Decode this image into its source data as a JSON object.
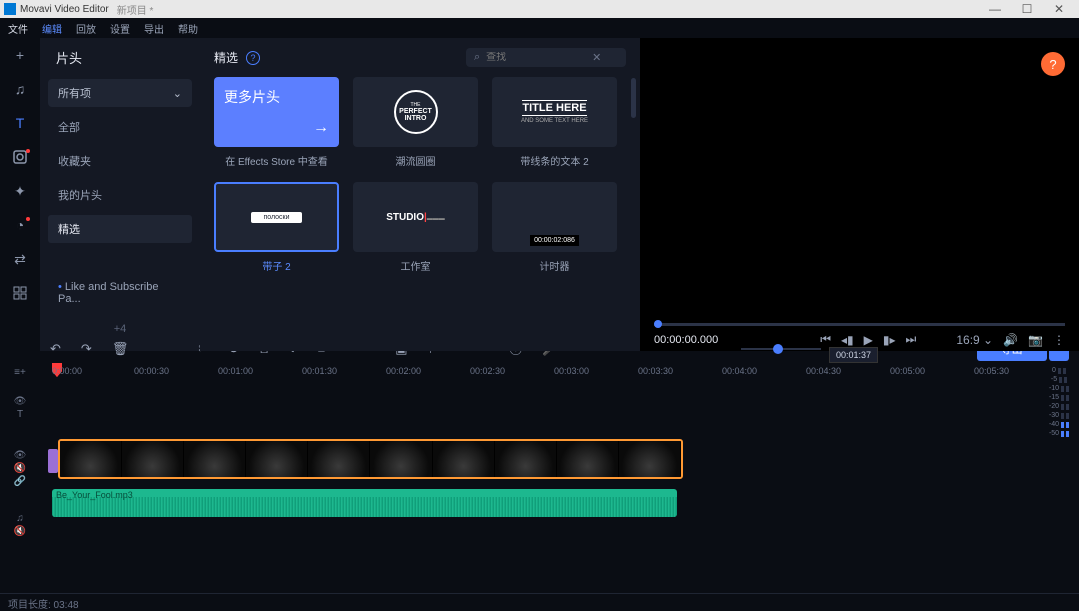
{
  "titlebar": {
    "app": "Movavi Video Editor",
    "project": "新项目 *"
  },
  "menubar": [
    "文件",
    "编辑",
    "回放",
    "设置",
    "导出",
    "帮助"
  ],
  "rail": {
    "items": [
      {
        "name": "add-icon",
        "glyph": "+"
      },
      {
        "name": "music-icon",
        "glyph": "♫"
      },
      {
        "name": "titles-icon",
        "glyph": "T",
        "active": true
      },
      {
        "name": "stickers-icon",
        "glyph": "⬚",
        "red_dot": true
      },
      {
        "name": "effects-icon",
        "glyph": "✦"
      },
      {
        "name": "transitions-icon",
        "glyph": "◔",
        "red_dot": true
      },
      {
        "name": "element-icon",
        "glyph": "⇄"
      },
      {
        "name": "more-icon",
        "glyph": "▫▫"
      }
    ]
  },
  "sidebar": {
    "title": "片头",
    "dropdown": "所有项",
    "items": [
      {
        "label": "全部"
      },
      {
        "label": "收藏夹"
      },
      {
        "label": "我的片头"
      },
      {
        "label": "精选",
        "active": true
      },
      {
        "label": "Like and Subscribe Pa...",
        "bullet": true
      },
      {
        "label": "+4"
      }
    ]
  },
  "intros": {
    "heading": "精选",
    "search_placeholder": "查找",
    "cards": [
      {
        "thumb_text": "更多片头",
        "label": "在 Effects Store 中查看",
        "style": "more"
      },
      {
        "thumb_text": "THE PERFECT INTRO",
        "label": "潮流圆圈",
        "style": "circle"
      },
      {
        "thumb_text_top": "TITLE HERE",
        "thumb_text_sub": "AND SOME TEXT HERE",
        "label": "带线条的文本 2",
        "style": "title"
      },
      {
        "thumb_text": "полоски",
        "label": "带子 2",
        "style": "ribbon",
        "selected": true
      },
      {
        "thumb_text": "STUDIO",
        "label": "工作室",
        "style": "studio"
      },
      {
        "thumb_text": "00:00:02:086",
        "label": "计时器",
        "style": "timer"
      }
    ]
  },
  "preview": {
    "timecode": "00:00:00.000",
    "aspect": "16:9",
    "tooltip": "00:01:37"
  },
  "toolbar": {
    "export": "导出"
  },
  "timeline": {
    "ticks": [
      "0:00:00",
      "00:00:30",
      "00:01:00",
      "00:01:30",
      "00:02:00",
      "00:02:30",
      "00:03:00",
      "00:03:30",
      "00:04:00",
      "00:04:30",
      "00:05:00",
      "00:05:30"
    ],
    "audio_clip": "Be_Your_Fool.mp3"
  },
  "meter_levels": [
    "0",
    "-5",
    "-10",
    "-15",
    "-20",
    "-30",
    "-40",
    "-50"
  ],
  "status": "项目长度: 03:48"
}
